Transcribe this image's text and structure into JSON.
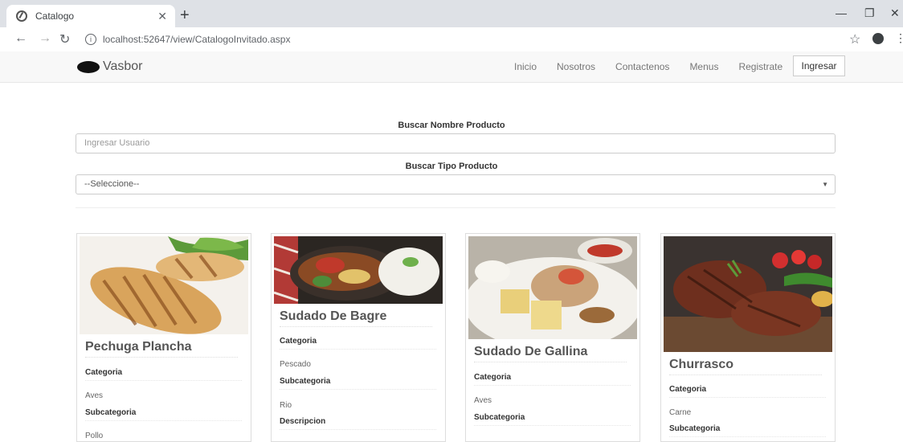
{
  "browser": {
    "tab_title": "Catalogo",
    "url": "localhost:52647/view/CatalogoInvitado.aspx"
  },
  "site": {
    "brand": "Vasbor",
    "nav": [
      "Inicio",
      "Nosotros",
      "Contactenos",
      "Menus",
      "Registrate"
    ],
    "login_button": "Ingresar"
  },
  "search": {
    "name_label": "Buscar Nombre Producto",
    "name_placeholder": "Ingresar Usuario",
    "type_label": "Buscar Tipo Producto",
    "type_selected": "--Seleccione--"
  },
  "products": [
    {
      "name": "Pechuga Plancha",
      "categoria_label": "Categoria",
      "categoria": "Aves",
      "subcategoria_label": "Subcategoria",
      "subcategoria": "Pollo"
    },
    {
      "name": "Sudado De Bagre",
      "categoria_label": "Categoria",
      "categoria": "Pescado",
      "subcategoria_label": "Subcategoria",
      "subcategoria": "Rio",
      "descripcion_label": "Descripcion"
    },
    {
      "name": "Sudado De Gallina",
      "categoria_label": "Categoria",
      "categoria": "Aves",
      "subcategoria_label": "Subcategoria"
    },
    {
      "name": "Churrasco",
      "categoria_label": "Categoria",
      "categoria": "Carne",
      "subcategoria_label": "Subcategoria"
    }
  ]
}
